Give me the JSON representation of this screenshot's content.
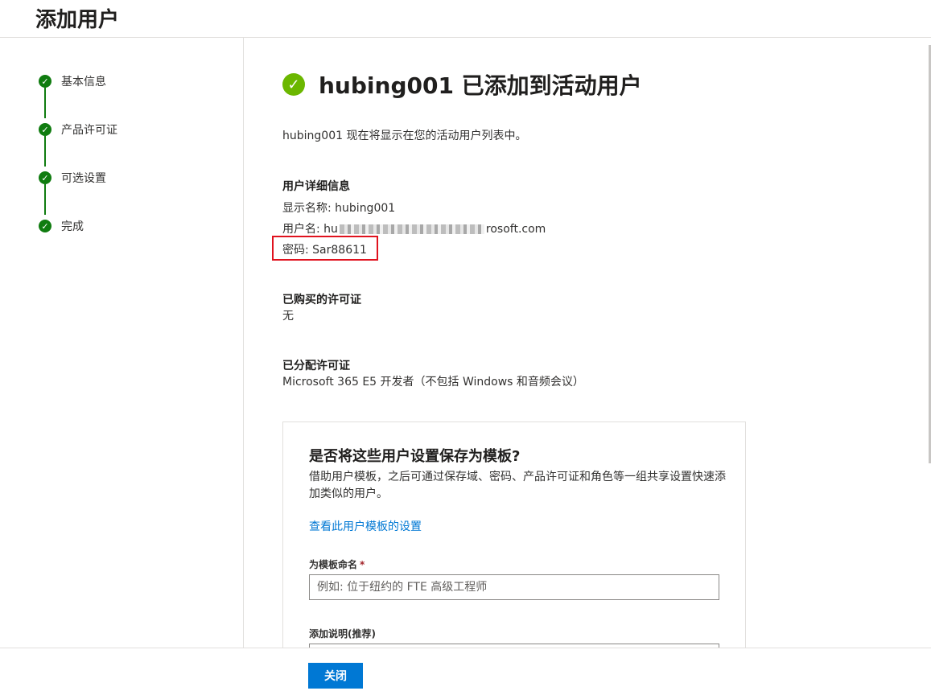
{
  "header": {
    "title": "添加用户"
  },
  "steps": [
    {
      "label": "基本信息",
      "icon": "checkmark-icon"
    },
    {
      "label": "产品许可证",
      "icon": "checkmark-icon"
    },
    {
      "label": "可选设置",
      "icon": "checkmark-icon"
    },
    {
      "label": "完成",
      "icon": "checkmark-icon"
    }
  ],
  "result": {
    "title": "hubing001 已添加到活动用户",
    "message": "hubing001 现在将显示在您的活动用户列表中。",
    "details_heading": "用户详细信息",
    "display_name": "显示名称: hubing001",
    "username_prefix": "用户名: hu",
    "username_suffix": "rosoft.com",
    "password": "密码: Sar88611",
    "purchased_heading": "已购买的许可证",
    "purchased_value": "无",
    "assigned_heading": "已分配许可证",
    "assigned_value": "Microsoft 365 E5 开发者（不包括 Windows 和音频会议）"
  },
  "template_card": {
    "title": "是否将这些用户设置保存为模板?",
    "description": "借助用户模板，之后可通过保存域、密码、产品许可证和角色等一组共享设置快速添加类似的用户。",
    "link": "查看此用户模板的设置",
    "name_label": "为模板命名",
    "required_mark": "*",
    "name_placeholder": "例如: 位于纽约的 FTE 高级工程师",
    "desc_label": "添加说明(推荐)"
  },
  "footer": {
    "close_label": "关闭"
  },
  "colors": {
    "accent": "#0078d4",
    "success": "#107c10",
    "highlight_box": "#e0121e"
  }
}
